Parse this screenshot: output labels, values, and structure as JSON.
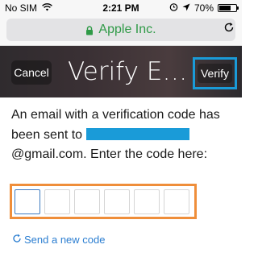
{
  "status_bar": {
    "carrier": "No SIM",
    "time": "2:21 PM",
    "battery_percent": "70%",
    "battery_level": 0.7
  },
  "address_bar": {
    "site_name": "Apple Inc.",
    "site_color": "#2f9a47"
  },
  "nav": {
    "cancel_label": "Cancel",
    "title": "Verify E…",
    "verify_label": "Verify",
    "highlight_color": "#1a9bd8"
  },
  "message": {
    "line1": "An email with a verification code has been sent to",
    "email_suffix": "@gmail.com. Enter the code here:"
  },
  "code_input": {
    "digits": [
      "",
      "",
      "",
      "",
      "",
      ""
    ],
    "highlight_color": "#ef8e3a"
  },
  "send_link": {
    "label": "Send a new code",
    "color": "#2b7ed1"
  }
}
